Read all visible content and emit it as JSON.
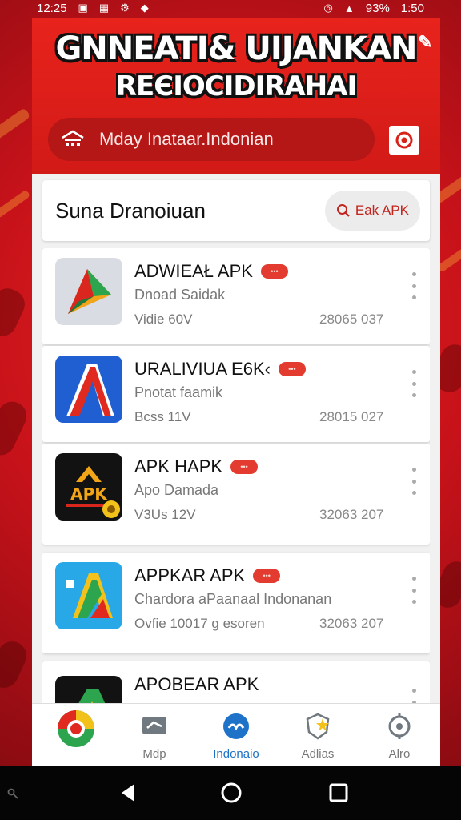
{
  "status_bar": {
    "time": "12:25",
    "battery": "93%",
    "clock_right": "1:50"
  },
  "header": {
    "title_line1": "GNNEATI& UIJANKAN",
    "title_line2": "REЄIOCIDIRAHAI",
    "search_text": "Mday Inataar.Indonian"
  },
  "section": {
    "title": "Suna Dranoiuan",
    "button_label": "Eak APK"
  },
  "apps": [
    {
      "name": "ADWIEAŁ APK",
      "subtitle": "Dnoad Saidak",
      "meta": "Vidie 60V",
      "date": "28065 037"
    },
    {
      "name": "URALIVIUA E6K‹",
      "subtitle": "Pnotat faamik",
      "meta": "Bcss 11V",
      "date": "28015 027"
    },
    {
      "name": "APK HAPK",
      "subtitle": "Apo Damada",
      "meta": "V3Us 12V",
      "date": "32063 207"
    },
    {
      "name": "APPKAR APK",
      "subtitle": "Chardora aPaanaal Indonanan",
      "meta": "Ovfie 10017 g esoren",
      "date": "32063 207"
    },
    {
      "name": "APOBEAR APK",
      "subtitle": "",
      "meta": "",
      "date": ""
    }
  ],
  "bottom_nav": [
    {
      "label": ""
    },
    {
      "label": "Mdp"
    },
    {
      "label": "Indonaio"
    },
    {
      "label": "Adlias"
    },
    {
      "label": "Alro"
    }
  ],
  "colors": {
    "accent_red": "#e8231c",
    "active_blue": "#1e72c8"
  }
}
